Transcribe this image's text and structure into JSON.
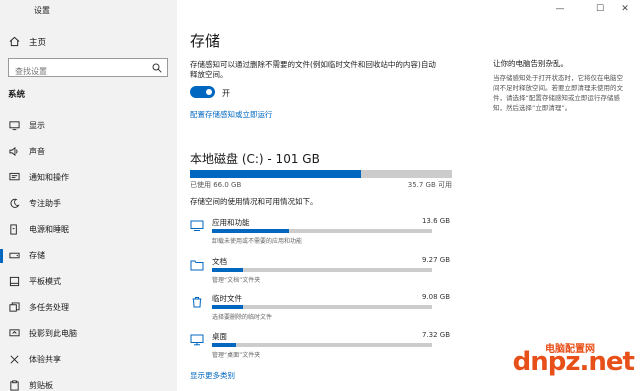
{
  "window": {
    "title": "设置",
    "minimize": "—",
    "maximize": "☐",
    "close": "✕"
  },
  "sidebar": {
    "home_label": "主页",
    "search_placeholder": "查找设置",
    "section_title": "系统",
    "items": [
      {
        "label": "显示",
        "icon": "monitor-icon"
      },
      {
        "label": "声音",
        "icon": "speaker-icon"
      },
      {
        "label": "通知和操作",
        "icon": "notification-icon"
      },
      {
        "label": "专注助手",
        "icon": "moon-icon"
      },
      {
        "label": "电源和睡眠",
        "icon": "power-icon"
      },
      {
        "label": "存储",
        "icon": "storage-icon",
        "active": true
      },
      {
        "label": "平板模式",
        "icon": "tablet-icon"
      },
      {
        "label": "多任务处理",
        "icon": "multitask-icon"
      },
      {
        "label": "投影到此电脑",
        "icon": "project-icon"
      },
      {
        "label": "体验共享",
        "icon": "share-icon"
      },
      {
        "label": "剪贴板",
        "icon": "clipboard-icon"
      }
    ]
  },
  "main": {
    "title": "存储",
    "description": "存储感知可以通过删除不需要的文件(例如临时文件和回收站中的内容)自动释放空间。",
    "toggle_state": "开",
    "configure_link": "配置存储感知或立即运行",
    "disk_title": "本地磁盘 (C:) - 101 GB",
    "used_label": "已使用 66.0 GB",
    "free_label": "35.7 GB 可用",
    "used_fraction": 0.653,
    "category_desc": "存储空间的使用情况和可用情况如下。",
    "categories": [
      {
        "name": "应用和功能",
        "size": "13.6 GB",
        "sub": "卸载未使用或不需要的应用和功能",
        "fraction": 0.35,
        "icon": "apps-icon"
      },
      {
        "name": "文档",
        "size": "9.27 GB",
        "sub": "管理“文档”文件夹",
        "fraction": 0.14,
        "icon": "documents-icon"
      },
      {
        "name": "临时文件",
        "size": "9.08 GB",
        "sub": "选择要删除的临时文件",
        "fraction": 0.14,
        "icon": "trash-icon"
      },
      {
        "name": "桌面",
        "size": "7.32 GB",
        "sub": "管理“桌面”文件夹",
        "fraction": 0.11,
        "icon": "desktop-icon"
      }
    ],
    "more_link": "显示更多类别"
  },
  "aside": {
    "title": "让你的电脑告别杂乱。",
    "body": "当存储感知处于打开状态时，它将仅在电脑空间不足时释放空间。若要立即清理未使用的文件，请选择“配置存储感知或立即运行存储感知，然后选择“立即清理”。"
  },
  "watermark": {
    "logo": "dnpz.net",
    "name": "电脑配置网"
  },
  "colors": {
    "accent": "#0067c0",
    "sidebar_bg": "#f2f2f2",
    "track": "#cccccc"
  }
}
